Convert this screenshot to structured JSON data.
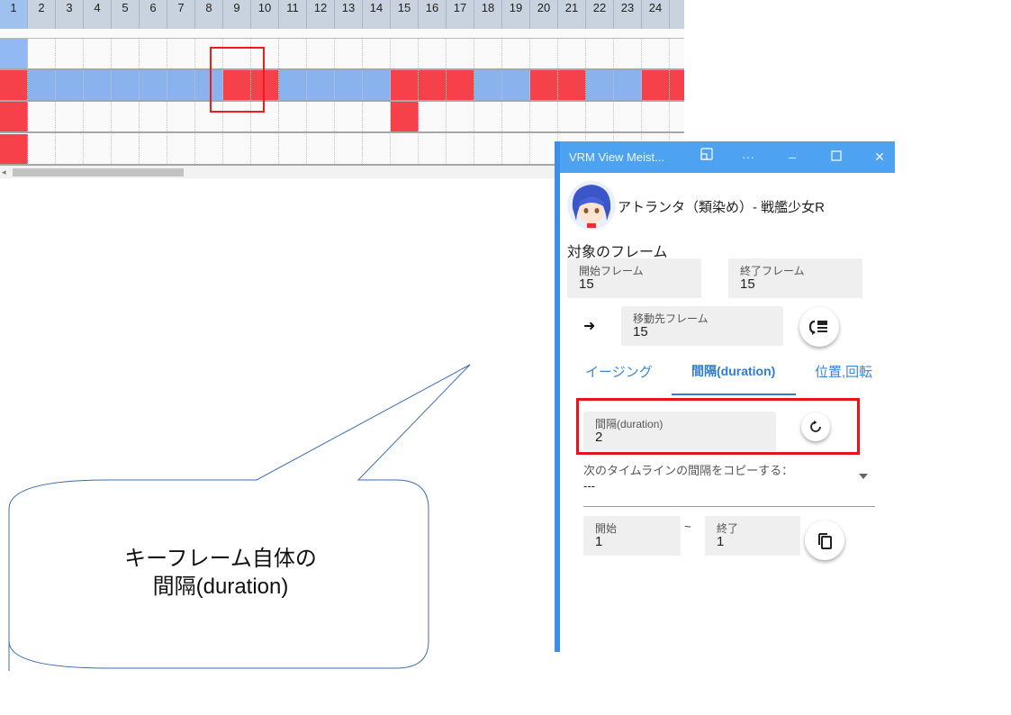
{
  "timeline": {
    "frames": [
      "1",
      "2",
      "3",
      "4",
      "5",
      "6",
      "7",
      "8",
      "9",
      "10",
      "11",
      "12",
      "13",
      "14",
      "15",
      "16",
      "17",
      "18",
      "19",
      "20",
      "21",
      "22",
      "23",
      "24"
    ],
    "rows": [
      {
        "first": "blue",
        "cells": "wwwwwwwwwwwwwwwwwwwwwwww"
      },
      {
        "first": "red",
        "cells": "bbbbbbbrrbbbbrrrbbrrbbrr"
      },
      {
        "first": "red",
        "cells": "wwwwwwwwwwwwwrwwwwwwwwww"
      },
      {
        "first": "red",
        "cells": "wwwwwwwwwwwwwwwwwwwwwwww"
      }
    ]
  },
  "callout": {
    "line1": "キーフレーム自体の",
    "line2": "間隔(duration)"
  },
  "window": {
    "title": "VRM View Meist...",
    "character_name": "アトランタ（類染め）- 戦艦少女R",
    "section_title": "対象のフレーム",
    "start_frame": {
      "label": "開始フレーム",
      "value": "15"
    },
    "end_frame": {
      "label": "終了フレーム",
      "value": "15"
    },
    "arrow": "➜",
    "dest_frame": {
      "label": "移動先フレーム",
      "value": "15"
    },
    "tabs": [
      "イージング",
      "間隔(duration)",
      "位置,回転"
    ],
    "active_tab": 1,
    "duration": {
      "label": "間隔(duration)",
      "value": "2"
    },
    "copy_select": {
      "label": "次のタイムラインの間隔をコピーする：",
      "value": "---"
    },
    "range_start": {
      "label": "開始",
      "value": "1"
    },
    "tilde": "~",
    "range_end": {
      "label": "終了",
      "value": "1"
    }
  },
  "colors": {
    "keyframe_red": "#f6404a",
    "track_blue": "#92b9f3",
    "header_bg": "#c9d2df",
    "titlebar_blue": "#4da3f1",
    "highlight_red": "#e3141b",
    "tab_blue": "#3a86d6"
  },
  "icons": [
    "restore-window-icon",
    "more-icon",
    "minimize-icon",
    "maximize-icon",
    "close-icon",
    "move-frames-icon",
    "reset-icon",
    "copy-icon"
  ]
}
